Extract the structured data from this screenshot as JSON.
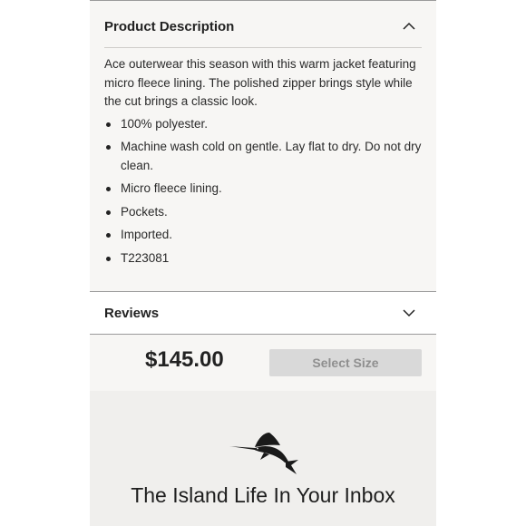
{
  "product_description": {
    "title": "Product Description",
    "toggle_icon": "chevron-up-icon",
    "intro": "Ace outerwear this season with this warm jacket featuring micro fleece lining. The polished zipper brings style while the cut brings a classic look.",
    "bullets": [
      "100% polyester.",
      "Machine wash cold on gentle. Lay flat to dry. Do not dry clean.",
      "Micro fleece lining.",
      "Pockets.",
      "Imported.",
      "T223081"
    ]
  },
  "reviews": {
    "title": "Reviews",
    "toggle_icon": "chevron-down-icon"
  },
  "purchase_bar": {
    "price": "$145.00",
    "select_size_label": "Select Size"
  },
  "newsletter": {
    "logo_icon": "marlin-logo-icon",
    "title": "The Island Life In Your Inbox"
  },
  "colors": {
    "panel_bg": "#f7f6f4",
    "button_disabled_bg": "#d9d9d9",
    "button_disabled_text": "#8f8f8f",
    "newsletter_bg": "#f0efed"
  }
}
